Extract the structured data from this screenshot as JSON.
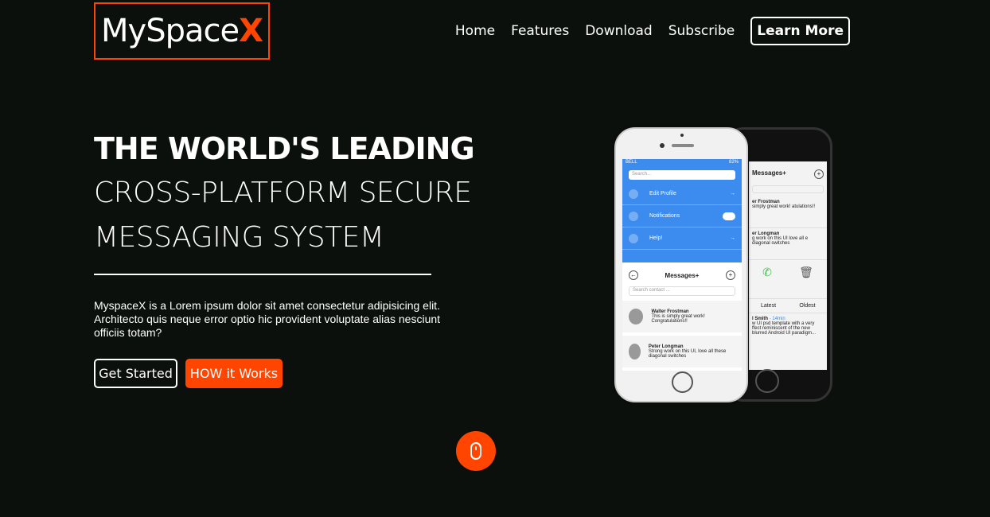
{
  "brand": {
    "name_main": "MySpace",
    "name_accent": "X"
  },
  "nav": {
    "items": [
      "Home",
      "Features",
      "Download",
      "Subscribe"
    ],
    "cta": "Learn More"
  },
  "hero": {
    "title_bold": "THE WORLD'S LEADING",
    "title_line2": "CROSS-PLATFORM SECURE",
    "title_line3": "MESSAGING SYSTEM",
    "description": "MyspaceX is a Lorem ipsum dolor sit amet consectetur adipisicing elit. Architecto quis neque error optio hic provident voluptate alias nesciunt officiis totam?",
    "btn_start": "Get Started",
    "btn_how": "HOW it Works"
  },
  "phone_front": {
    "carrier": "BELL",
    "battery": "82%",
    "search_placeholder": "Search...",
    "menu": [
      {
        "label": "Edit Profile",
        "icon": "arrow-down-icon"
      },
      {
        "label": "Notifications",
        "icon": "bell-icon"
      },
      {
        "label": "Help!",
        "icon": "help-icon"
      }
    ],
    "messages_title": "Messages+",
    "search_contact": "Search contact ...",
    "messages": [
      {
        "name": "Walter Frostman",
        "text": "This is simply great work! Congratulations!!"
      },
      {
        "name": "Peter Longman",
        "text": "Strong work on this UI, love all these diagonal switches"
      }
    ]
  },
  "phone_back": {
    "messages_title": "Messages+",
    "rows": [
      {
        "name": "er Frostman",
        "text": "simply great work! atulations!!"
      },
      {
        "name": "er Longman",
        "text": "g work on this UI love all e diagonal switches"
      }
    ],
    "tabs": [
      "Latest",
      "Oldest"
    ],
    "footer_name": "l Smith",
    "footer_time": "- 14min",
    "footer_text": "w UI psd template with a very ffect reminiscent of the new blurred Android UI paradigm..."
  },
  "colors": {
    "accent": "#ff4500",
    "background": "#0b100d",
    "phone_blue": "#3c8cf0"
  }
}
